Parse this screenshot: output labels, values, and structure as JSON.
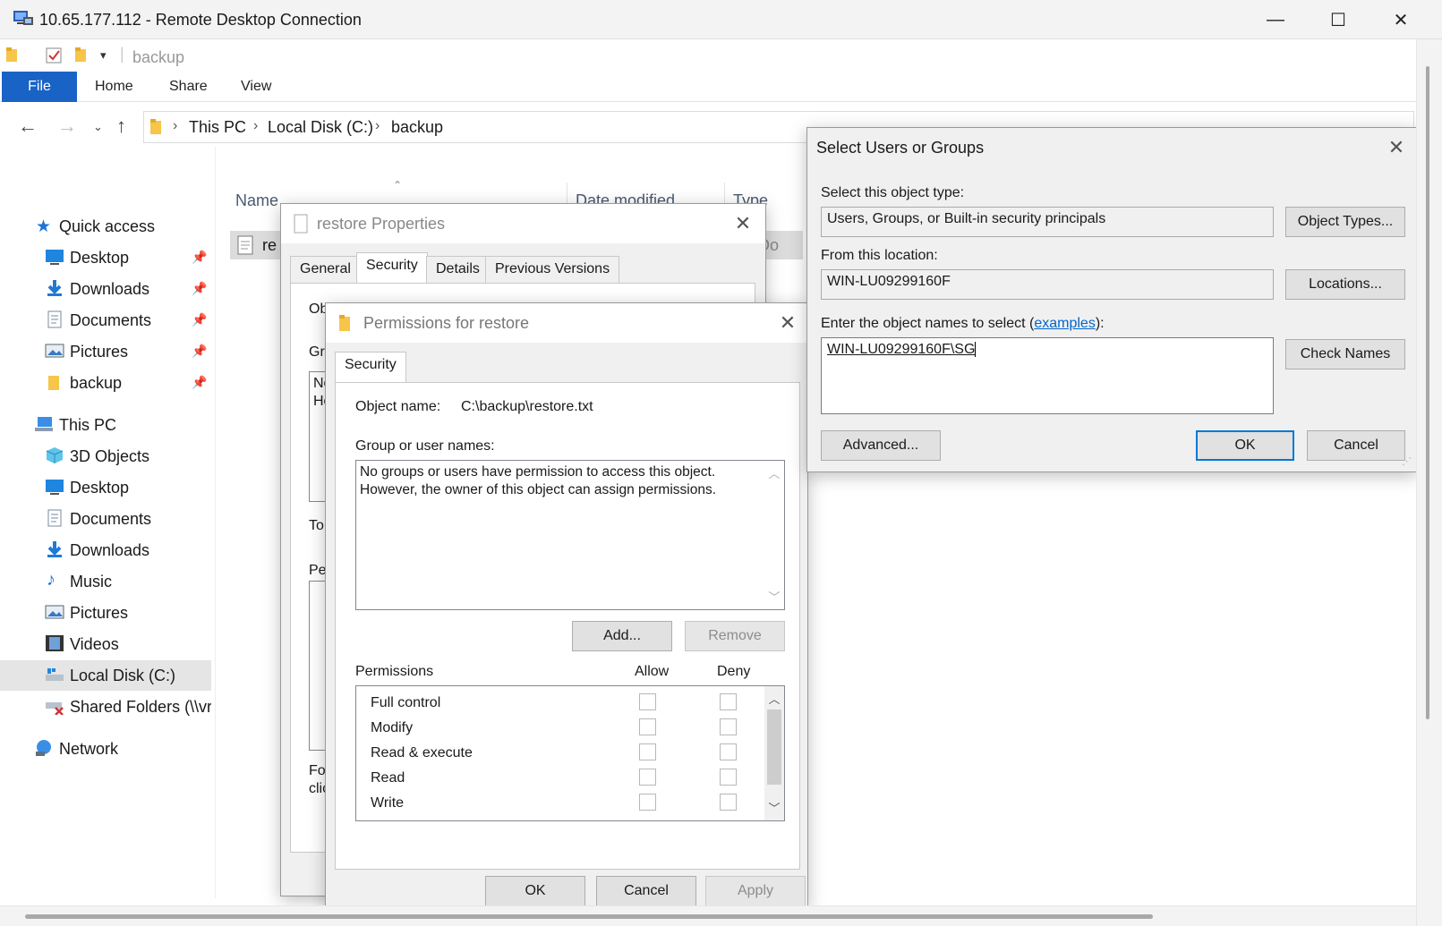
{
  "rdp": {
    "title": "10.65.177.112 - Remote Desktop Connection",
    "minimize": "—",
    "maximize": "☐",
    "close": "✕"
  },
  "explorer": {
    "qat_path": "backup",
    "ribbon": {
      "file": "File",
      "home": "Home",
      "share": "Share",
      "view": "View"
    },
    "breadcrumb": [
      "This PC",
      "Local Disk (C:)",
      "backup"
    ],
    "sidebar": [
      {
        "label": "Quick access",
        "icon": "star-icon"
      },
      {
        "label": "Desktop",
        "icon": "desktop-icon"
      },
      {
        "label": "Downloads",
        "icon": "download-icon"
      },
      {
        "label": "Documents",
        "icon": "documents-icon"
      },
      {
        "label": "Pictures",
        "icon": "pictures-icon"
      },
      {
        "label": "backup",
        "icon": "folder-icon"
      },
      {
        "label": "This PC",
        "icon": "computer-icon"
      },
      {
        "label": "3D Objects",
        "icon": "cube-icon"
      },
      {
        "label": "Desktop",
        "icon": "desktop-icon"
      },
      {
        "label": "Documents",
        "icon": "documents-icon"
      },
      {
        "label": "Downloads",
        "icon": "download-icon"
      },
      {
        "label": "Music",
        "icon": "music-icon"
      },
      {
        "label": "Pictures",
        "icon": "pictures-icon"
      },
      {
        "label": "Videos",
        "icon": "videos-icon"
      },
      {
        "label": "Local Disk (C:)",
        "icon": "drive-icon"
      },
      {
        "label": "Shared Folders (\\\\vr",
        "icon": "network-drive-icon"
      },
      {
        "label": "Network",
        "icon": "network-icon"
      }
    ],
    "columns": {
      "name": "Name",
      "date_modified": "Date modified",
      "type": "Type"
    },
    "file_row": {
      "name": "re",
      "type_partial": "Txt Do"
    }
  },
  "props": {
    "title": "restore Properties",
    "tabs": [
      "General",
      "Security",
      "Details",
      "Previous Versions"
    ],
    "partial": {
      "obj": "Obj",
      "gr": "Gr",
      "no": "No",
      "ho": "Ho",
      "to": "To",
      "pe": "Pe",
      "fo": "Fo",
      "clic": "clic"
    }
  },
  "perms": {
    "title": "Permissions for restore",
    "tab": "Security",
    "object_name_label": "Object name:",
    "object_name_value": "C:\\backup\\restore.txt",
    "group_label": "Group or user names:",
    "group_text_1": "No groups or users have permission to access this object.",
    "group_text_2": "However, the owner of this object can assign permissions.",
    "add": "Add...",
    "remove": "Remove",
    "permissions_header": "Permissions",
    "allow": "Allow",
    "deny": "Deny",
    "rows": [
      "Full control",
      "Modify",
      "Read & execute",
      "Read",
      "Write"
    ],
    "ok": "OK",
    "cancel": "Cancel",
    "apply": "Apply"
  },
  "select": {
    "title": "Select Users or Groups",
    "object_type_label": "Select this object type:",
    "object_type_value": "Users, Groups, or Built-in security principals",
    "object_types_btn": "Object Types...",
    "location_label": "From this location:",
    "location_value": "WIN-LU09299160F",
    "locations_btn": "Locations...",
    "enter_label_pre": "Enter the object names to select (",
    "enter_label_link": "examples",
    "enter_label_post": "):",
    "names_value": "WIN-LU09299160F\\SG",
    "check_names": "Check Names",
    "advanced": "Advanced...",
    "ok": "OK",
    "cancel": "Cancel"
  }
}
